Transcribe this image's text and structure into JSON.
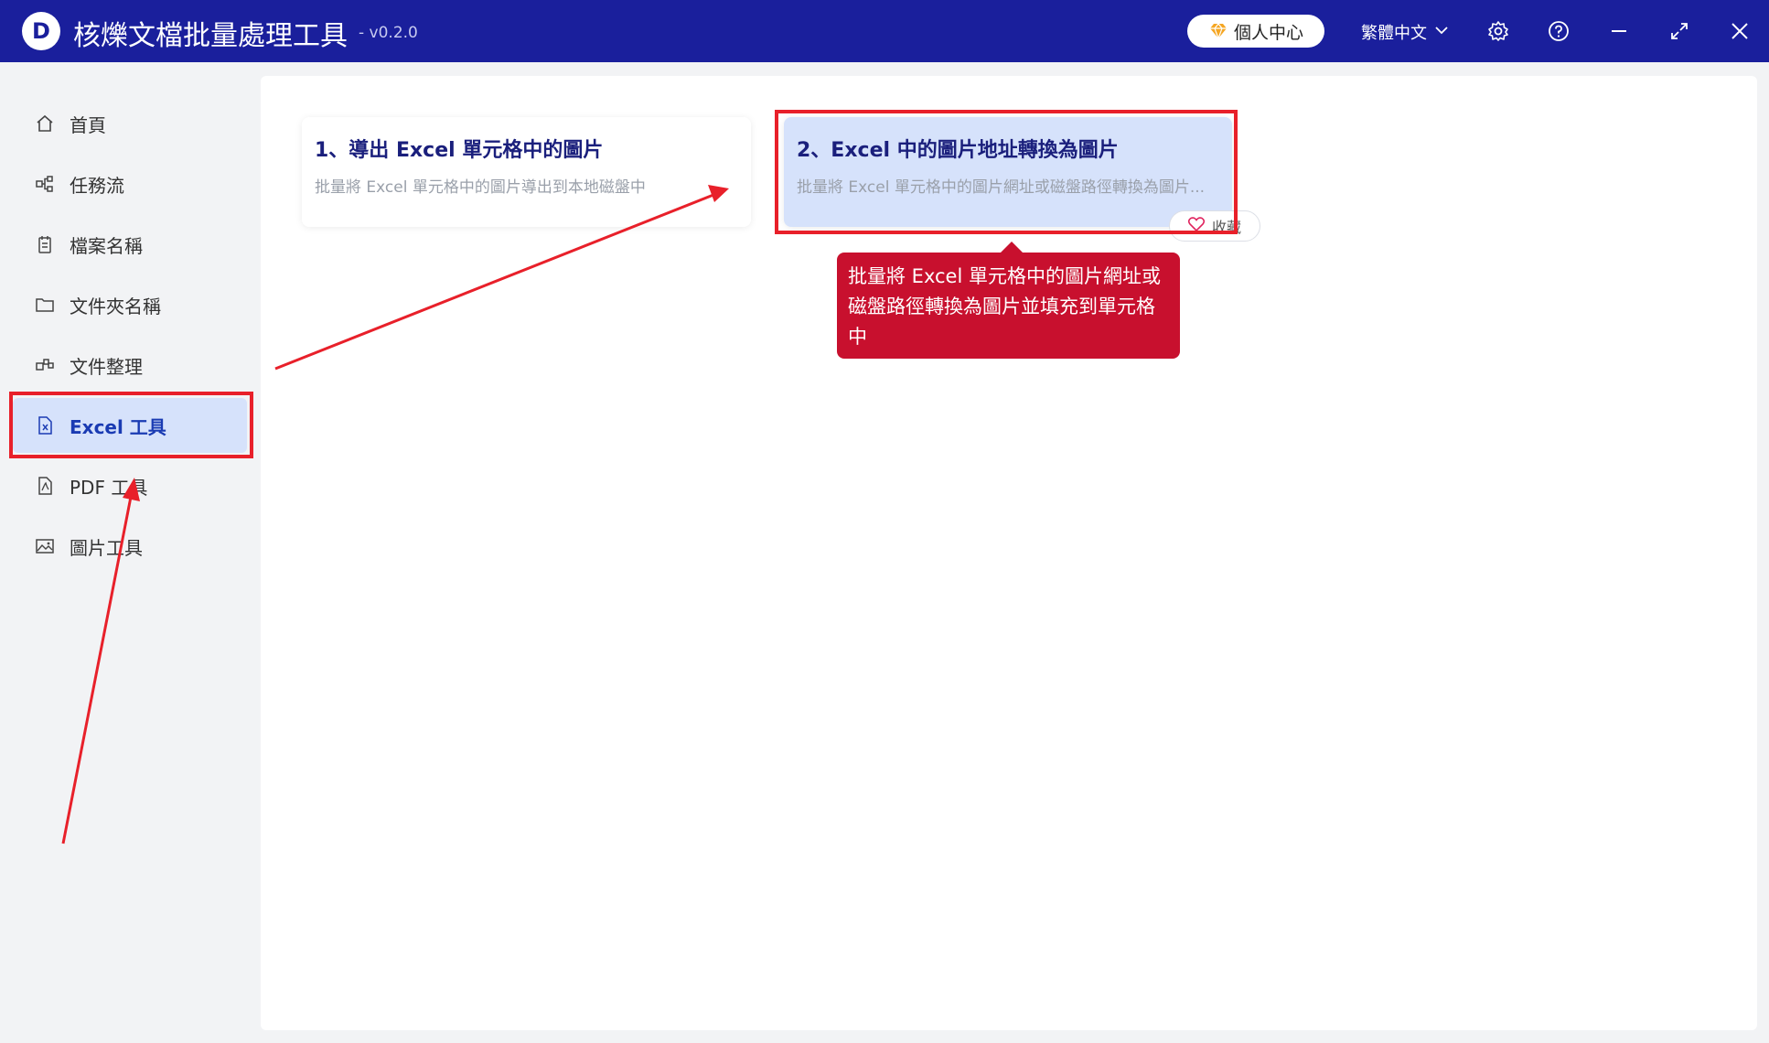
{
  "app": {
    "title": "核爍文檔批量處理工具",
    "version": "- v0.2.0",
    "logo_letter": "D"
  },
  "header": {
    "user_center": "個人中心",
    "language": "繁體中文",
    "icons": [
      "gear-icon",
      "help-icon",
      "minimize-icon",
      "maximize-icon",
      "close-icon"
    ]
  },
  "sidebar": {
    "items": [
      {
        "label": "首頁",
        "icon": "home-icon"
      },
      {
        "label": "任務流",
        "icon": "workflow-icon"
      },
      {
        "label": "檔案名稱",
        "icon": "file-icon"
      },
      {
        "label": "文件夾名稱",
        "icon": "folder-icon"
      },
      {
        "label": "文件整理",
        "icon": "organize-icon"
      },
      {
        "label": "Excel 工具",
        "icon": "excel-icon",
        "active": true
      },
      {
        "label": "PDF 工具",
        "icon": "pdf-icon"
      },
      {
        "label": "圖片工具",
        "icon": "image-icon"
      }
    ]
  },
  "cards": [
    {
      "title": "1、導出 Excel 單元格中的圖片",
      "desc": "批量將 Excel 單元格中的圖片導出到本地磁盤中"
    },
    {
      "title": "2、Excel 中的圖片地址轉換為圖片",
      "desc": "批量將 Excel 單元格中的圖片網址或磁盤路徑轉換為圖片..."
    }
  ],
  "favorite_label": "收藏",
  "tooltip": {
    "text": "批量將 Excel 單元格中的圖片網址或磁盤路徑轉換為圖片並填充到單元格中"
  },
  "colors": {
    "titlebar": "#1a1f9c",
    "active_bg": "#d6e2fb",
    "tooltip_bg": "#c8102e",
    "annotation": "#e8202a"
  }
}
